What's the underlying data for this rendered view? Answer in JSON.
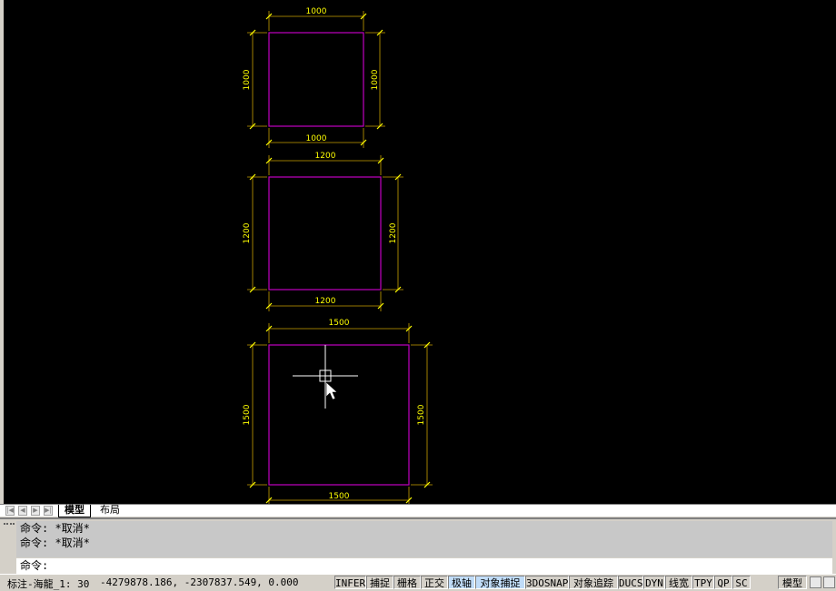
{
  "squares": [
    {
      "top": "1000",
      "bottom": "1000",
      "left": "1000",
      "right": "1000"
    },
    {
      "top": "1200",
      "bottom": "1200",
      "left": "1200",
      "right": "1200"
    },
    {
      "top": "1500",
      "bottom": "1500",
      "left": "1500",
      "right": "1500"
    }
  ],
  "colors": {
    "shape": "#c000c0",
    "dimension": "#ffff00",
    "canvas": "#000000",
    "crosshair": "#ffffff"
  },
  "tabs": {
    "model": "模型",
    "layout": "布局"
  },
  "commands": {
    "history": [
      "命令: *取消*",
      "命令: *取消*"
    ],
    "prompt": "命令:"
  },
  "status": {
    "annotation_scale": "标注-海龍_1: 30",
    "coordinates": "-4279878.186, -2307837.549, 0.000",
    "buttons": [
      "INFER",
      "捕捉",
      "栅格",
      "正交",
      "极轴",
      "对象捕捉",
      "3DOSNAP",
      "对象追踪",
      "DUCS",
      "DYN",
      "线宽",
      "TPY",
      "QP",
      "SC"
    ],
    "active_buttons": [
      "极轴",
      "对象捕捉"
    ],
    "space": "模型"
  }
}
